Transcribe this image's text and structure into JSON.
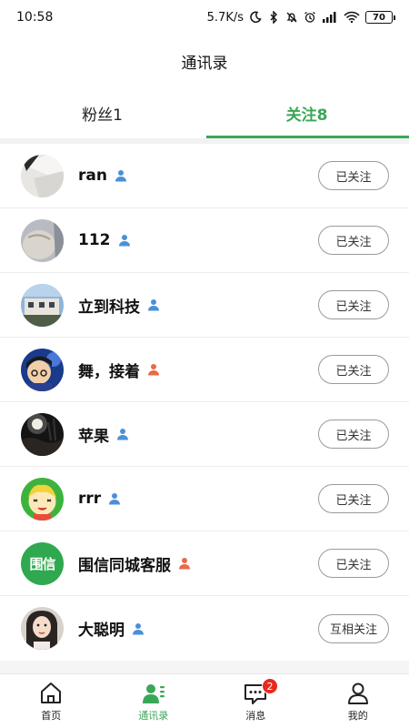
{
  "status_bar": {
    "time": "10:58",
    "speed": "5.7K/s",
    "battery": "70",
    "signal_label": "HD"
  },
  "header": {
    "title": "通讯录"
  },
  "tabs": [
    {
      "label": "粉丝1",
      "active": false
    },
    {
      "label": "关注8",
      "active": true
    }
  ],
  "accent_color": "#3aa757",
  "contacts": [
    {
      "name": "ran",
      "gender_icon": "male-person-icon",
      "gender_color": "#4a90d9",
      "button": "已关注"
    },
    {
      "name": "112",
      "gender_icon": "male-person-icon",
      "gender_color": "#4a90d9",
      "button": "已关注"
    },
    {
      "name": "立到科技",
      "gender_icon": "male-person-icon",
      "gender_color": "#4a90d9",
      "button": "已关注"
    },
    {
      "name": "舞，接着",
      "gender_icon": "female-person-icon",
      "gender_color": "#e86a4a",
      "button": "已关注"
    },
    {
      "name": "苹果",
      "gender_icon": "male-person-icon",
      "gender_color": "#4a90d9",
      "button": "已关注"
    },
    {
      "name": "rrr",
      "gender_icon": "male-person-icon",
      "gender_color": "#4a90d9",
      "button": "已关注"
    },
    {
      "name": "围信同城客服",
      "gender_icon": "female-person-icon",
      "gender_color": "#e86a4a",
      "button": "已关注",
      "avatar_text": "围信"
    },
    {
      "name": "大聪明",
      "gender_icon": "male-person-icon",
      "gender_color": "#4a90d9",
      "button": "互相关注"
    }
  ],
  "bottom_nav": [
    {
      "label": "首页",
      "icon": "home-icon",
      "active": false
    },
    {
      "label": "通讯录",
      "icon": "contacts-icon",
      "active": true
    },
    {
      "label": "消息",
      "icon": "message-icon",
      "active": false,
      "badge": "2"
    },
    {
      "label": "我的",
      "icon": "profile-icon",
      "active": false
    }
  ]
}
